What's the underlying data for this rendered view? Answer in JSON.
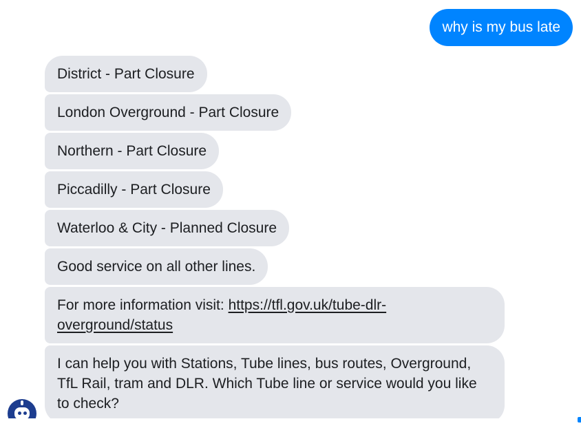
{
  "conversation": {
    "user_message": "why is my bus late",
    "bot_messages": [
      "District - Part Closure",
      "London Overground - Part Closure",
      "Northern - Part Closure",
      "Piccadilly - Part Closure",
      "Waterloo & City - Planned Closure",
      "Good service on all other lines."
    ],
    "more_info": {
      "prefix": "For more information visit: ",
      "link_text": "https://tfl.gov.uk/tube-dlr-overground/status"
    },
    "help_message": "I can help you with Stations, Tube lines, bus routes, Overground, TfL Rail, tram and DLR. Which Tube line or service would you like to check?"
  },
  "colors": {
    "user_bubble": "#0084ff",
    "bot_bubble": "#e4e6eb",
    "avatar": "#1d3d8f"
  },
  "icons": {
    "bot_avatar": "robot-avatar-icon"
  }
}
